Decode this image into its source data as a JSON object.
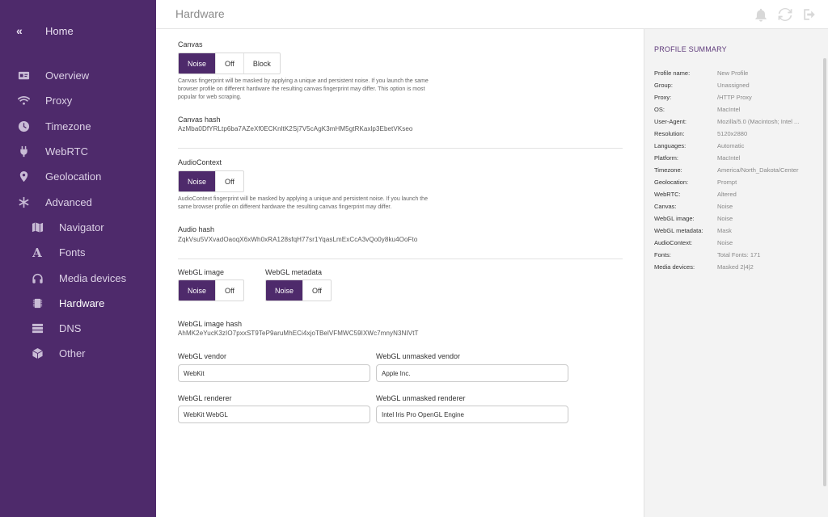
{
  "header": {
    "title": "Hardware"
  },
  "sidebar": {
    "home": "Home",
    "items": [
      {
        "label": "Overview",
        "icon": "id-card-icon"
      },
      {
        "label": "Proxy",
        "icon": "wifi-icon"
      },
      {
        "label": "Timezone",
        "icon": "clock-icon"
      },
      {
        "label": "WebRTC",
        "icon": "plug-icon"
      },
      {
        "label": "Geolocation",
        "icon": "location-pin-icon"
      },
      {
        "label": "Advanced",
        "icon": "asterisk-icon"
      }
    ],
    "subitems": [
      {
        "label": "Navigator",
        "icon": "map-icon"
      },
      {
        "label": "Fonts",
        "icon": "font-icon"
      },
      {
        "label": "Media devices",
        "icon": "headphones-icon"
      },
      {
        "label": "Hardware",
        "icon": "chip-icon"
      },
      {
        "label": "DNS",
        "icon": "server-icon"
      },
      {
        "label": "Other",
        "icon": "cube-icon"
      }
    ]
  },
  "canvas": {
    "label": "Canvas",
    "options": [
      "Noise",
      "Off",
      "Block"
    ],
    "selected": "Noise",
    "description_1": "Canvas fingerprint will be masked by applying a unique and persistent noise. If you launch the same",
    "description_2": "browser profile on different hardware the resulting canvas fingerprint may differ. This option is most",
    "description_3": "popular for web scraping.",
    "hash_label": "Canvas hash",
    "hash": "AzMba0DfYRLtp6ba7AZeXf0ECKnltK2Sj7V5cAgK3mHM5gtRKaxlp3EbetVKseo"
  },
  "audio": {
    "label": "AudioContext",
    "options": [
      "Noise",
      "Off"
    ],
    "selected": "Noise",
    "description_1": "AudioContext fingerprint will be masked by applying a unique and persistent noise. If you launch the",
    "description_2": "same browser profile on different hardware the resulting canvas fingerprint may differ.",
    "hash_label": "Audio hash",
    "hash": "ZqkVsu5VXvadOaoqX6xWh0xRA128sfqH77sr1YqasLmExCcA3vQo0y8ku4OoFto"
  },
  "webgl": {
    "image_label": "WebGL image",
    "image_options": [
      "Noise",
      "Off"
    ],
    "metadata_label": "WebGL metadata",
    "metadata_options": [
      "Noise",
      "Off"
    ],
    "image_hash_label": "WebGL image hash",
    "image_hash": "AhMK2eYucK3zIO7pxxST9TeP9aruMhECi4xjoTBelVFMWC59IXWc7mnyN3NIVtT",
    "vendor_label": "WebGL vendor",
    "vendor_value": "WebKit",
    "unmasked_vendor_label": "WebGL unmasked vendor",
    "unmasked_vendor_value": "Apple Inc.",
    "renderer_label": "WebGL renderer",
    "renderer_value": "WebKit WebGL",
    "unmasked_renderer_label": "WebGL unmasked renderer",
    "unmasked_renderer_value": "Intel Iris Pro OpenGL Engine"
  },
  "summary": {
    "title": "PROFILE SUMMARY",
    "rows": [
      {
        "k": "Profile name:",
        "v": "New Profile"
      },
      {
        "k": "Group:",
        "v": "Unassigned"
      },
      {
        "k": "Proxy:",
        "v": "/HTTP Proxy"
      },
      {
        "k": "OS:",
        "v": "MacIntel"
      },
      {
        "k": "User-Agent:",
        "v": "Mozilla/5.0 (Macintosh; Intel ..."
      },
      {
        "k": "Resolution:",
        "v": "5120x2880"
      },
      {
        "k": "Languages:",
        "v": "Automatic"
      },
      {
        "k": "Platform:",
        "v": "MacIntel"
      },
      {
        "k": "Timezone:",
        "v": "America/North_Dakota/Center"
      },
      {
        "k": "Geolocation:",
        "v": "Prompt"
      },
      {
        "k": "WebRTC:",
        "v": "Altered"
      },
      {
        "k": "Canvas:",
        "v": "Noise"
      },
      {
        "k": "WebGL image:",
        "v": "Noise"
      },
      {
        "k": "WebGL metadata:",
        "v": "Mask"
      },
      {
        "k": "AudioContext:",
        "v": "Noise"
      },
      {
        "k": "Fonts:",
        "v": "Total Fonts: 171"
      },
      {
        "k": "Media devices:",
        "v": "Masked 2|4|2"
      }
    ]
  },
  "colors": {
    "accent": "#4e2a6b",
    "sidebar": "#4e2a6b"
  }
}
